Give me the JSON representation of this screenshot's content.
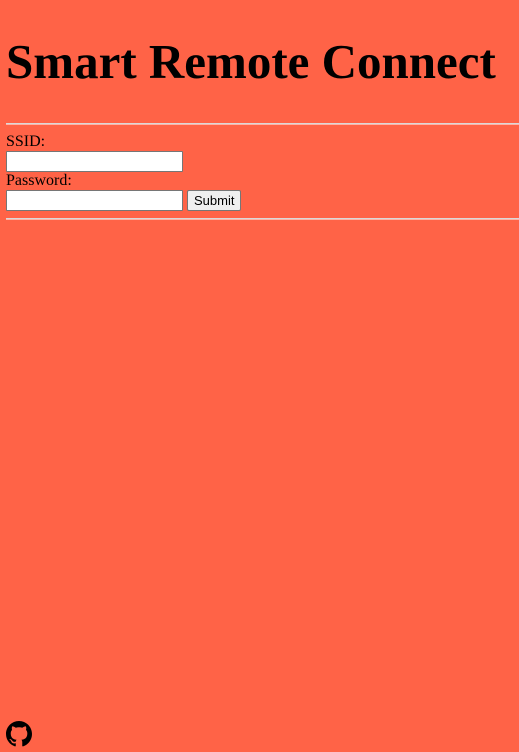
{
  "header": {
    "title": "Smart Remote Connect"
  },
  "form": {
    "ssid_label": "SSID:",
    "ssid_value": "",
    "ssid_placeholder": "",
    "password_label": "Password:",
    "password_value": "",
    "password_placeholder": "",
    "submit_label": "Submit"
  },
  "footer": {
    "link_icon": "github-icon"
  },
  "colors": {
    "background": "#ff6347",
    "text": "#000000"
  }
}
